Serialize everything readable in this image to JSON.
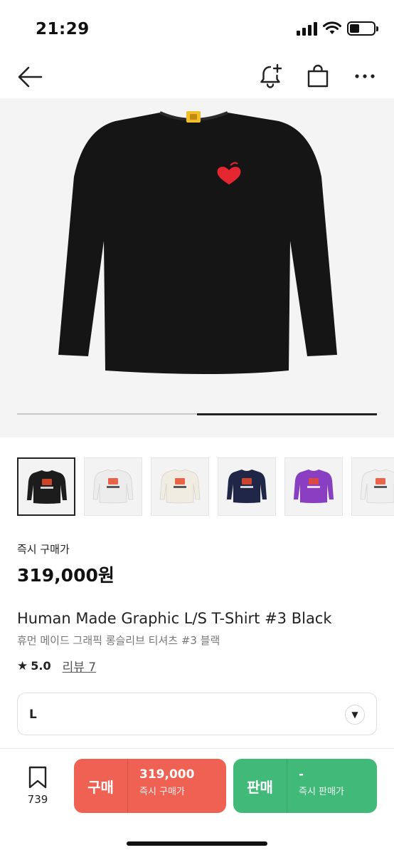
{
  "status_bar": {
    "time": "21:29"
  },
  "nav": {
    "back_icon": "arrow-left-icon",
    "alert_icon": "bell-plus-icon",
    "bag_icon": "shopping-bag-icon",
    "more_icon": "more-horizontal-icon"
  },
  "hero": {
    "slide_fraction": 0.5
  },
  "thumbnails": [
    {
      "label": "black",
      "color": "#1c1c1c",
      "selected": true
    },
    {
      "label": "white",
      "color": "#ececec",
      "selected": false
    },
    {
      "label": "cream",
      "color": "#f1ece2",
      "selected": false
    },
    {
      "label": "navy",
      "color": "#1f2647",
      "selected": false
    },
    {
      "label": "purple",
      "color": "#8a3fc3",
      "selected": false
    },
    {
      "label": "white-heart",
      "color": "#efefef",
      "selected": false
    }
  ],
  "price": {
    "label": "즉시 구매가",
    "value": "319,000원"
  },
  "product": {
    "title_en": "Human Made Graphic L/S T-Shirt #3 Black",
    "title_ko": "휴먼 메이드 그래픽 롱슬리브 티셔츠 #3 블랙",
    "rating": "5.0",
    "review_link": "리뷰 7"
  },
  "size_select": {
    "value": "L"
  },
  "bottom_bar": {
    "wish_count": "739",
    "buy": {
      "label": "구매",
      "price": "319,000",
      "sub": "즉시 구매가",
      "color": "#ef6253"
    },
    "sell": {
      "label": "판매",
      "price": "-",
      "sub": "즉시 판매가",
      "color": "#41b979"
    }
  }
}
